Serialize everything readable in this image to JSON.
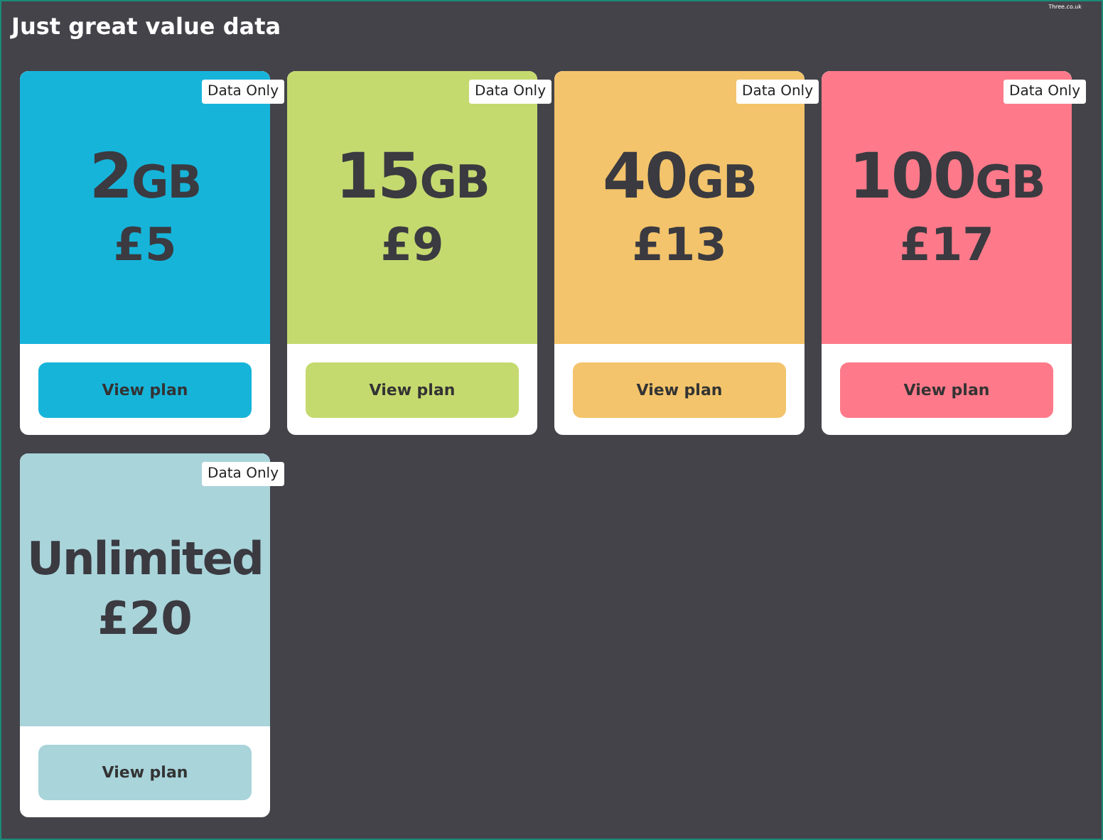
{
  "header": {
    "title": "Just great value data",
    "logo_text": "Three.co.uk"
  },
  "plans": [
    {
      "amount": "2",
      "unit": "GB",
      "price": "£5",
      "badge": "Data Only",
      "button": "View plan",
      "color": "#17b4da"
    },
    {
      "amount": "15",
      "unit": "GB",
      "price": "£9",
      "badge": "Data Only",
      "button": "View plan",
      "color": "#c4da6f"
    },
    {
      "amount": "40",
      "unit": "GB",
      "price": "£13",
      "badge": "Data Only",
      "button": "View plan",
      "color": "#f3c46b"
    },
    {
      "amount": "100",
      "unit": "GB",
      "price": "£17",
      "badge": "Data Only",
      "button": "View plan",
      "color": "#fe7a8a"
    },
    {
      "amount": "Unlimited",
      "price": "£20",
      "badge": "Data Only",
      "button": "View plan",
      "color": "#a8d4da"
    }
  ]
}
